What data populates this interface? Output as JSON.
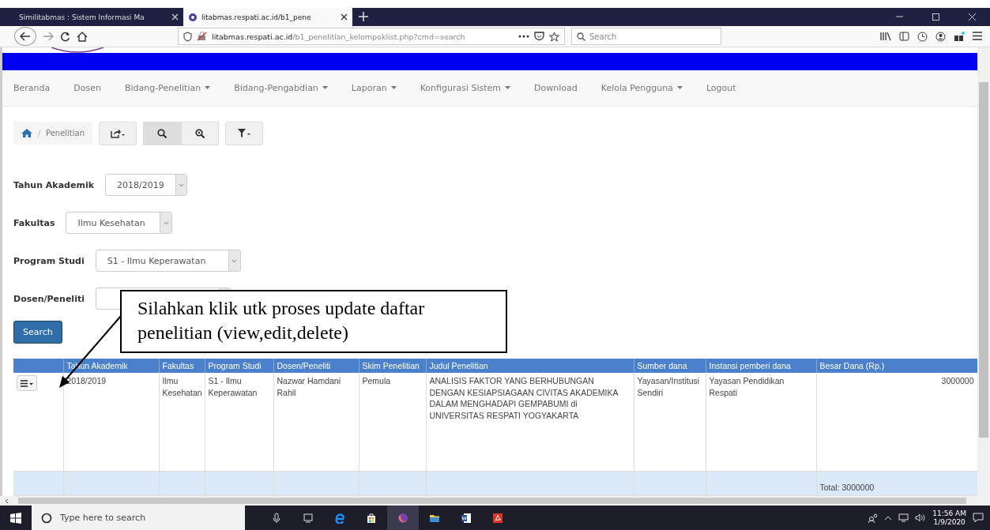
{
  "browser": {
    "tabs": [
      {
        "title": "Similitabmas : Sistem Informasi Ma",
        "selected": false
      },
      {
        "title": "litabmas.respati.ac.id/b1_pene",
        "selected": true
      }
    ],
    "url_host": "litabmas.respati.ac.id",
    "url_path": "/b1_penelitian_kelompoklist.php?cmd=search",
    "search_placeholder": "Search"
  },
  "menu": [
    {
      "label": "Beranda",
      "dropdown": false
    },
    {
      "label": "Dosen",
      "dropdown": false
    },
    {
      "label": "Bidang-Penelitian",
      "dropdown": true
    },
    {
      "label": "Bidang-Pengabdian",
      "dropdown": true
    },
    {
      "label": "Laporan",
      "dropdown": true
    },
    {
      "label": "Konfigurasi Sistem",
      "dropdown": true
    },
    {
      "label": "Download",
      "dropdown": false
    },
    {
      "label": "Kelola Pengguna",
      "dropdown": true
    },
    {
      "label": "Logout",
      "dropdown": false
    }
  ],
  "breadcrumb": "Penelitian",
  "filters": [
    {
      "label": "Tahun Akademik",
      "value": "2018/2019"
    },
    {
      "label": "Fakultas",
      "value": "Ilmu Kesehatan"
    },
    {
      "label": "Program Studi",
      "value": "S1 - Ilmu Keperawatan"
    },
    {
      "label": "Dosen/Peneliti"
    }
  ],
  "search_button": "Search",
  "table": {
    "columns": [
      "Tahun Akademik",
      "Fakultas",
      "Program Studi",
      "Dosen/Peneliti",
      "Skim Penelitian",
      "Judul Penelitian",
      "Sumber dana",
      "Instansi pemberi dana",
      "Besar Dana (Rp.)"
    ],
    "rows": [
      {
        "cells": [
          "2018/2019",
          "Ilmu Kesehatan",
          "S1 - Ilmu Keperawatan",
          "Nazwar Hamdani Rahil",
          "Pemula",
          "ANALISIS FAKTOR YANG BERHUBUNGAN DENGAN KESIAPSIAGAAN CIVITAS AKADEMIKA DALAM MENGHADAPI GEMPABUMI di UNIVERSITAS RESPATI YOGYAKARTA",
          "Yayasan/Institusi Sendiri",
          "Yayasan Pendidikan Respati",
          "3000000"
        ]
      }
    ],
    "total": "Total: 3000000"
  },
  "callout": "Silahkan klik utk proses update daftar penelitian (view,edit,delete)",
  "taskbar": {
    "search_placeholder": "Type here to search",
    "time": "11:56 AM",
    "date": "1/9/2020"
  }
}
